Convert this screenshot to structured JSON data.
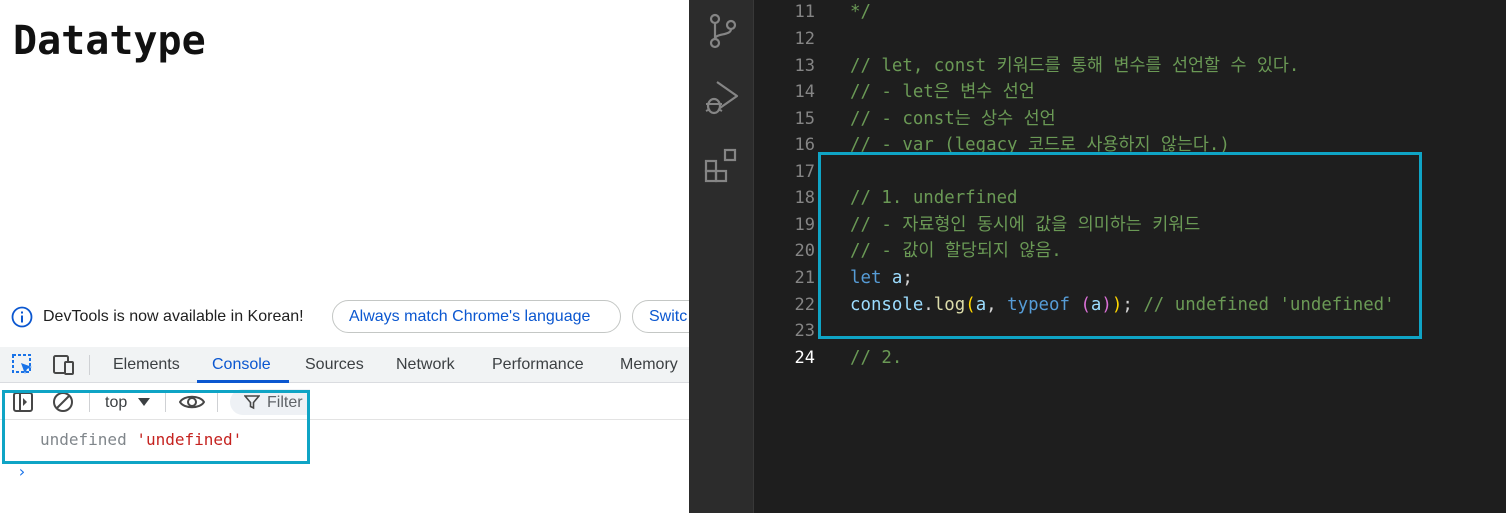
{
  "browser": {
    "heading": "Datatype",
    "infobar": {
      "message": "DevTools is now available in Korean!",
      "match_button": "Always match Chrome's language",
      "switch_button": "Switc"
    },
    "devtools": {
      "tabs": [
        "Elements",
        "Console",
        "Sources",
        "Network",
        "Performance",
        "Memory"
      ],
      "active_tab": "Console",
      "context": "top",
      "filter_placeholder": "Filter",
      "output": {
        "value1": "undefined",
        "value2": "'undefined'"
      },
      "prompt": "›"
    }
  },
  "editor": {
    "line_numbers": [
      "11",
      "12",
      "13",
      "14",
      "15",
      "16",
      "17",
      "18",
      "19",
      "20",
      "21",
      "22",
      "23",
      "24"
    ],
    "active_line": "24",
    "lines": {
      "l11": "*/",
      "l13": "// let, const 키워드를 통해 변수를 선언할 수 있다.",
      "l14": "// - let은 변수 선언",
      "l15": "// - const는 상수 선언",
      "l16": "// - var (legacy 코드로 사용하지 않는다.)",
      "l18": "// 1. underfined",
      "l19": "// - 자료형인 동시에 값을 의미하는 키워드",
      "l20": "// - 값이 할당되지 않음.",
      "l21_kw": "let",
      "l21_var": "a",
      "l21_semi": ";",
      "l22_obj": "console",
      "l22_dot": ".",
      "l22_fn": "log",
      "l22_p1": "(",
      "l22_arg": "a",
      "l22_comma": ", ",
      "l22_kw": "typeof",
      "l22_sp": " ",
      "l22_p2": "(",
      "l22_arg2": "a",
      "l22_p3": ")",
      "l22_p4": ")",
      "l22_semi": ";",
      "l22_comment": " // undefined 'undefined'",
      "l24": "// 2."
    }
  },
  "colors": {
    "highlight_border": "#0fa4c5",
    "editor_bg": "#1e1e1e",
    "comment": "#6a9955",
    "keyword": "#569cd6",
    "devtools_accent": "#0b57d0"
  },
  "icons": {
    "activity_bar": [
      "source-control-icon",
      "run-debug-icon",
      "extensions-icon"
    ],
    "devtools": [
      "inspect-element-icon",
      "device-toolbar-icon"
    ],
    "console_toolbar": [
      "sidebar-toggle-icon",
      "clear-console-icon",
      "eye-icon",
      "filter-icon"
    ]
  }
}
